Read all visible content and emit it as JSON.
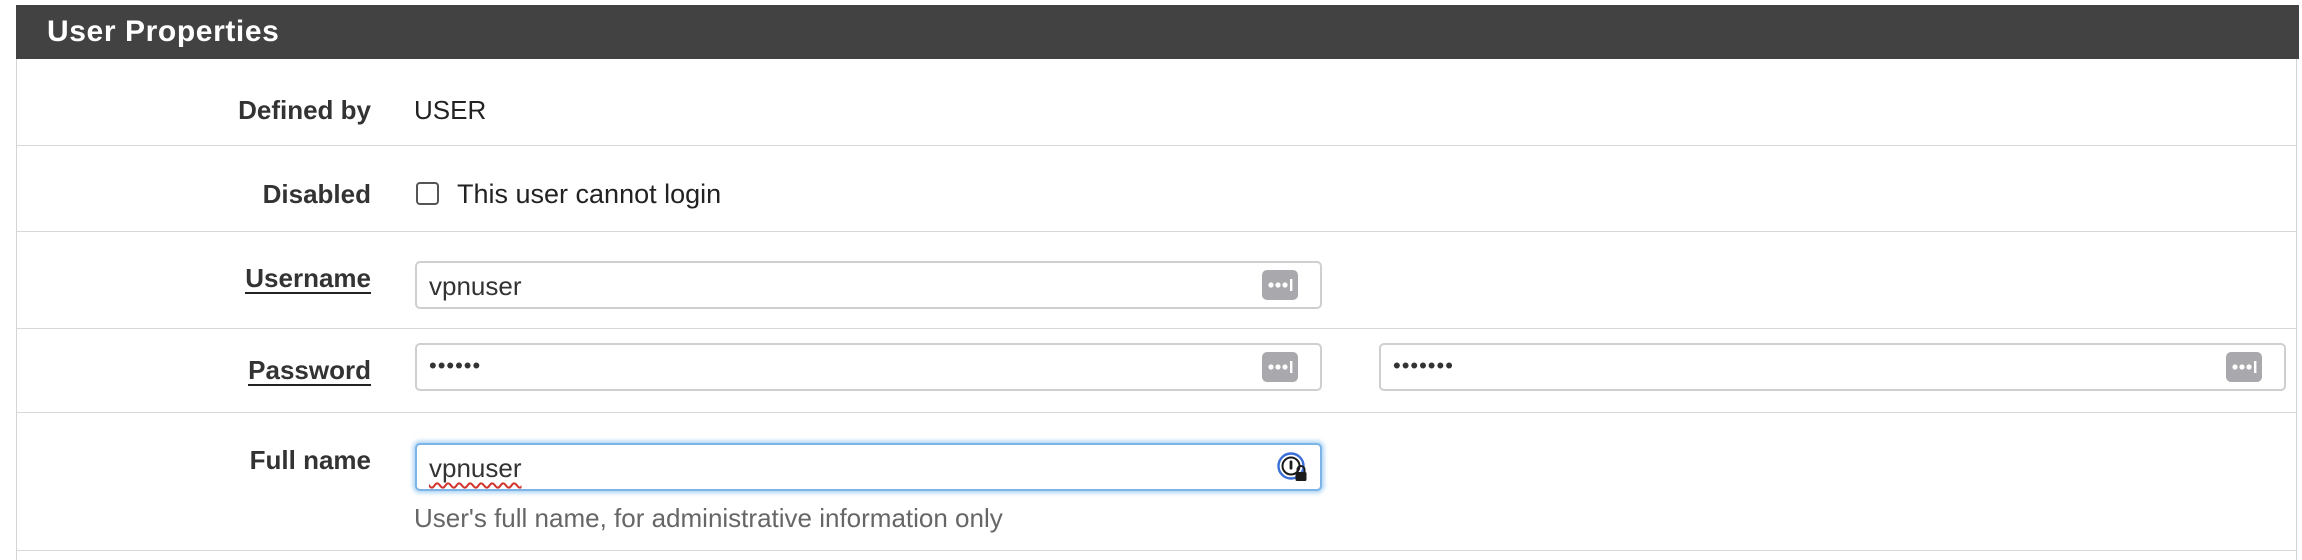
{
  "panel": {
    "title": "User Properties"
  },
  "form": {
    "defined_by": {
      "label": "Defined by",
      "value": "USER"
    },
    "disabled": {
      "label": "Disabled",
      "checkbox_label": "This user cannot login",
      "checked": false
    },
    "username": {
      "label": "Username",
      "value": "vpnuser",
      "icon": "keychain-autofill-icon"
    },
    "password": {
      "label": "Password",
      "value_masked": "••••••",
      "confirm_masked": "•••••••",
      "icon": "keychain-autofill-icon"
    },
    "full_name": {
      "label": "Full name",
      "value": "vpnuser",
      "help": "User's full name, for administrative information only",
      "icon": "password-manager-icon"
    }
  },
  "colors": {
    "header_bg": "#424242",
    "header_text": "#ffffff",
    "focus_border": "#7cb4e8",
    "help_text": "#666666"
  }
}
